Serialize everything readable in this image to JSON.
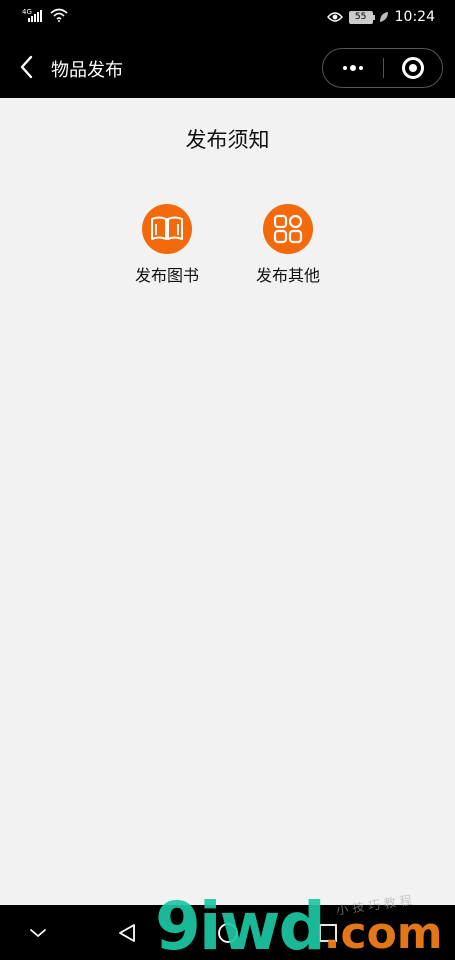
{
  "status_bar": {
    "network": "4G",
    "battery": "55",
    "time": "10:24"
  },
  "nav": {
    "title": "物品发布"
  },
  "page": {
    "notice_title": "发布须知",
    "actions": [
      {
        "label": "发布图书",
        "icon": "book-icon"
      },
      {
        "label": "发布其他",
        "icon": "grid-icon"
      }
    ]
  },
  "colors": {
    "accent": "#f26a0c",
    "bar_bg": "#000000",
    "page_bg": "#f2f2f2"
  },
  "watermark": {
    "main": "9iwd",
    "dot_com": ".com",
    "sub": "小技巧教程"
  }
}
